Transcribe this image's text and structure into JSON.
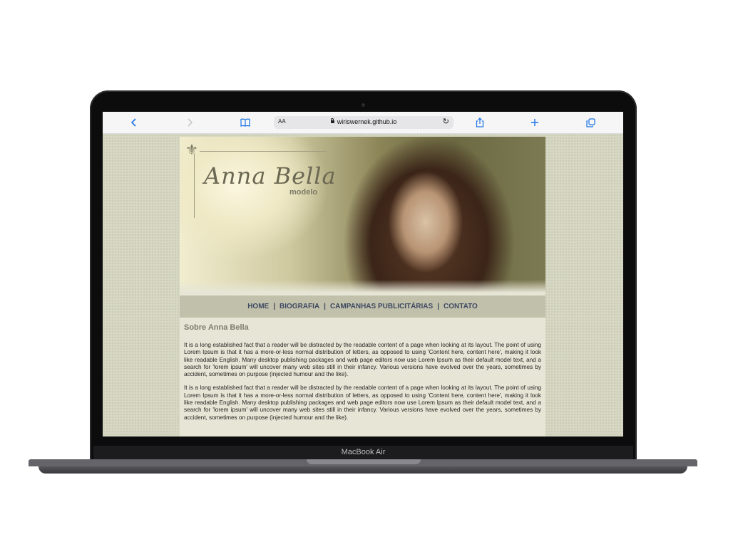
{
  "device": {
    "brand_label": "MacBook Air"
  },
  "browser": {
    "address_aa": "AA",
    "url": "wiriswernek.github.io",
    "icons": [
      "back-icon",
      "forward-icon",
      "bookmarks-icon",
      "lock-icon",
      "reload-icon",
      "share-icon",
      "new-tab-icon",
      "tabs-icon"
    ]
  },
  "site": {
    "logo": {
      "name": "Anna Bella",
      "subtitle": "modelo"
    },
    "nav": [
      {
        "label": "HOME"
      },
      {
        "label": "BIOGRAFIA"
      },
      {
        "label": "CAMPANHAS PUBLICITÁRIAS"
      },
      {
        "label": "CONTATO"
      }
    ],
    "nav_separator": "|",
    "content": {
      "heading": "Sobre Anna Bella",
      "paragraphs": [
        "It is a long established fact that a reader will be distracted by the readable content of a page when looking at its layout. The point of using Lorem Ipsum is that it has a more-or-less normal distribution of letters, as opposed to using 'Content here, content here', making it look like readable English. Many desktop publishing packages and web page editors now use Lorem Ipsum as their default model text, and a search for 'lorem ipsum' will uncover many web sites still in their infancy. Various versions have evolved over the years, sometimes by accident, sometimes on purpose (injected humour and the like).",
        "It is a long established fact that a reader will be distracted by the readable content of a page when looking at its layout. The point of using Lorem Ipsum is that it has a more-or-less normal distribution of letters, as opposed to using 'Content here, content here', making it look like readable English. Many desktop publishing packages and web page editors now use Lorem Ipsum as their default model text, and a search for 'lorem ipsum' will uncover many web sites still in their infancy. Various versions have evolved over the years, sometimes by accident, sometimes on purpose (injected humour and the like)."
      ]
    }
  },
  "colors": {
    "accent": "#1a73e8",
    "nav_bar": "#c1c0aa",
    "nav_text": "#3e4a63",
    "page_bg": "#d7d8c4",
    "content_bg": "#e7e6d6"
  }
}
